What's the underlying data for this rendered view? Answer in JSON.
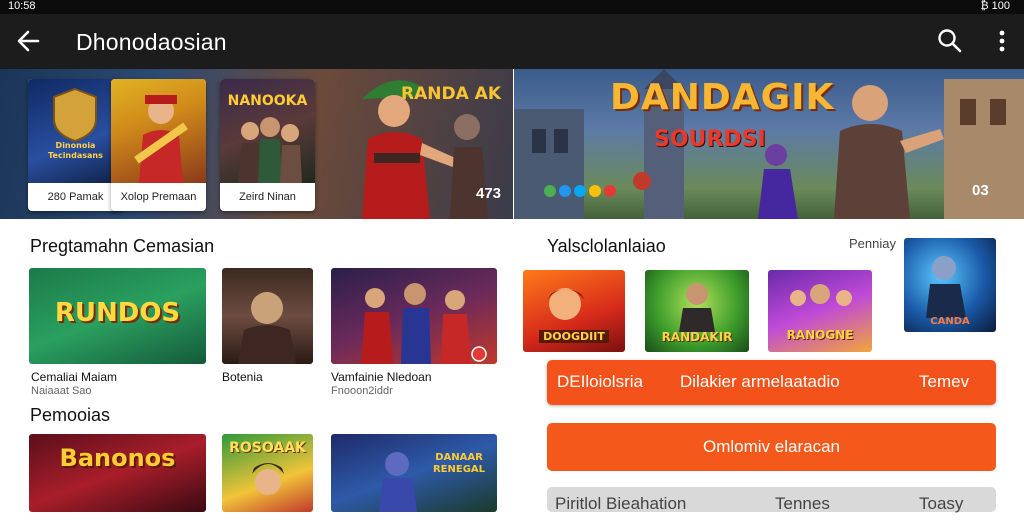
{
  "status_bar": {
    "left_text": "10:58",
    "right_text": "₿ 100"
  },
  "app_bar": {
    "title": "Dhonodaosian"
  },
  "hero_left": {
    "cards": [
      {
        "caption": "280 Pamak",
        "badge": "Dinonoia Tecindasans"
      },
      {
        "caption": "Xolop Premaan",
        "badge": ""
      },
      {
        "caption": "Zeird Ninan",
        "badge": "NANOOKA"
      }
    ],
    "title_art": "NANOOKA",
    "title_right": "RANDA AK",
    "count": "473"
  },
  "hero_right": {
    "logo_line1": "DANDAGIK",
    "logo_line2": "SOURDSI",
    "count": "03",
    "dot_colors": [
      "#4caf50",
      "#2196f3",
      "#03a9f4",
      "#ffc107",
      "#e53935"
    ]
  },
  "section1": {
    "title": "Pregtamahn Cemasian",
    "tiles": [
      {
        "label": "RUNDOS",
        "caption": "Cemaliai Maiam",
        "sub": "Naiaaat Sao"
      },
      {
        "label": "",
        "caption": "Botenia",
        "sub": ""
      },
      {
        "label": "",
        "caption": "Vamfainie Nledoan",
        "sub": "Fnooon2iddr"
      }
    ]
  },
  "section2": {
    "title": "Pemooias",
    "tiles": [
      {
        "label": "Banonos"
      },
      {
        "label": "ROSOAAK"
      },
      {
        "label": "DANAAR RENEGAL"
      }
    ]
  },
  "right_section": {
    "title": "Yalsclolanlaiao",
    "partners": "Penniay",
    "thumbs": [
      {
        "label": "DOOGDIIT"
      },
      {
        "label": "RANDAKIR"
      },
      {
        "label": "RANOGNE"
      },
      {
        "label": "CANDA"
      }
    ],
    "buttons": [
      {
        "left": "DEIloiolsria",
        "middle": "Dilakier armelaatadio",
        "right": "Temev"
      },
      {
        "left": "",
        "middle": "Omlomiv elaracan",
        "right": ""
      },
      {
        "left": "Piritlol Bieahation",
        "middle": "Tennes",
        "right": "Toasy"
      }
    ]
  },
  "colors": {
    "accent_orange": "#f3531a",
    "app_bar": "#1c1c1c",
    "status_bar": "#0c0c0c"
  }
}
